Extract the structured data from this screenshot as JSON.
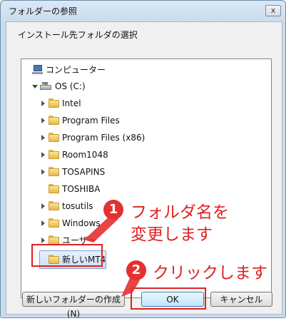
{
  "window": {
    "title": "フォルダーの参照",
    "close_glyph": "x"
  },
  "dialog": {
    "description": "インストール先フォルダの選択"
  },
  "tree": {
    "computer": "コンピューター",
    "drive": "OS (C:)",
    "folders": [
      "Intel",
      "Program Files",
      "Program Files (x86)",
      "Room1048",
      "TOSAPINS",
      "TOSHIBA",
      "tosutils",
      "Windows",
      "ユーザー"
    ],
    "new_folder": "新しいMT4"
  },
  "buttons": {
    "make_folder": "新しいフォルダーの作成(N)",
    "ok": "OK",
    "cancel": "キャンセル"
  },
  "annotations": {
    "step1_number": "1",
    "step1_line1": "フォルダ名を",
    "step1_line2": "変更します",
    "step2_number": "2",
    "step2_text": "クリックします",
    "accent_color": "#e02020"
  }
}
